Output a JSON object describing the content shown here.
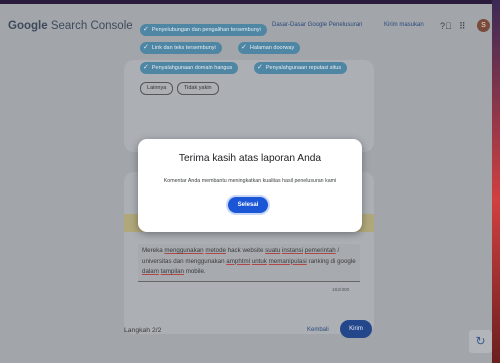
{
  "header": {
    "logo_google": "Google",
    "logo_product": "Search Console",
    "nav_basics": "Dasar-Dasar Google Penelusuran",
    "nav_feedback": "Kirim masukan",
    "avatar_letter": "S",
    "help_icon": "help-icon",
    "apps_icon": "apps-grid-icon"
  },
  "chips": [
    {
      "label": "Penyelubungan dan pengalihan tersembunyi",
      "selected": true
    },
    {
      "label": "Link dan teks tersembunyi",
      "selected": true
    },
    {
      "label": "Halaman doorway",
      "selected": true
    },
    {
      "label": "Penyalahgunaan domain hangus",
      "selected": true
    },
    {
      "label": "Penyalahgunaan reputasi situs",
      "selected": true
    },
    {
      "label": "Lainnya",
      "selected": false
    },
    {
      "label": "Tidak yakin",
      "selected": false
    }
  ],
  "description": {
    "text_words": [
      {
        "t": "Mereka ",
        "u": false
      },
      {
        "t": "menggunakan",
        "u": true
      },
      {
        "t": " ",
        "u": false
      },
      {
        "t": "metode",
        "u": true
      },
      {
        "t": " hack website ",
        "u": false
      },
      {
        "t": "suatu",
        "u": true
      },
      {
        "t": " ",
        "u": false
      },
      {
        "t": "instansi",
        "u": true
      },
      {
        "t": " ",
        "u": false
      },
      {
        "t": "pemerintah",
        "u": true
      },
      {
        "t": " / universitas dan menggunakan ",
        "u": false
      },
      {
        "t": "amphtml",
        "u": true
      },
      {
        "t": " ",
        "u": false
      },
      {
        "t": "untuk",
        "u": true
      },
      {
        "t": " ",
        "u": false
      },
      {
        "t": "memanipulasi",
        "u": true
      },
      {
        "t": " ranking di google ",
        "u": false
      },
      {
        "t": "dalam",
        "u": true
      },
      {
        "t": " ",
        "u": false
      },
      {
        "t": "tampilan",
        "u": true
      },
      {
        "t": " mobile.",
        "u": false
      }
    ],
    "counter": "162/300"
  },
  "footer": {
    "step": "Langkah 2/2",
    "back": "Kembali",
    "next": "Kirim"
  },
  "modal": {
    "title": "Terima kasih atas laporan Anda",
    "body": "Komentar Anda membantu meningkatkan kualitas hasil penelusuran kami",
    "button": "Selesai"
  },
  "colors": {
    "chip_selected": "#4e86a4",
    "primary_button": "#1a56d6",
    "overlay_page": "#a2a6ab"
  }
}
